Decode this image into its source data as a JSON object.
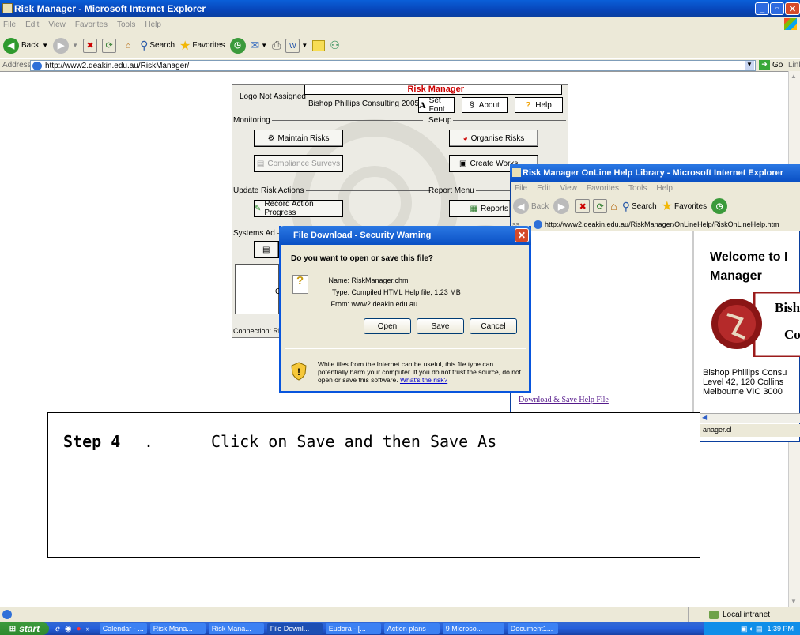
{
  "window": {
    "title": "Risk Manager - Microsoft Internet Explorer"
  },
  "menu": [
    "File",
    "Edit",
    "View",
    "Favorites",
    "Tools",
    "Help"
  ],
  "toolbar": {
    "back": "Back",
    "search": "Search",
    "favorites": "Favorites"
  },
  "address": {
    "label": "Address",
    "url": "http://www2.deakin.edu.au/RiskManager/",
    "go": "Go",
    "links": "Links"
  },
  "app": {
    "title": "Risk Manager",
    "logo": "Logo Not Assigned",
    "company": "Bishop Phillips Consulting 2005",
    "set_font": "Set Font",
    "about": "About",
    "help": "Help",
    "groups": {
      "monitoring": "Monitoring",
      "setup": "Set-up",
      "update": "Update Risk Actions",
      "report": "Report Menu",
      "systems": "Systems Ad"
    },
    "buttons": {
      "maintain": "Maintain Risks",
      "organise": "Organise Risks",
      "compliance": "Compliance Surveys",
      "create_workshop": "Create Works",
      "record": "Record Action Progress",
      "reports": "Reports"
    },
    "connection": "Connection: Ri",
    "partial_c": "C"
  },
  "help_window": {
    "title": "Risk Manager OnLine Help Library - Microsoft Internet Explorer",
    "url": "http://www2.deakin.edu.au/RiskManager/OnLineHelp/RiskOnLineHelp.htm",
    "addr_partial": "ss",
    "welcome_line1": "Welcome to I",
    "welcome_line2": "Manager",
    "logo_text1": "Bish",
    "logo_text2": "Co",
    "company_lines": [
      "Bishop Phillips Consu",
      "Level 42, 120 Collins",
      "Melbourne VIC 3000"
    ],
    "download_link": "Download & Save Help File",
    "status_partial": "anager.cl"
  },
  "dialog": {
    "title": "File Download - Security Warning",
    "question": "Do you want to open or save this file?",
    "name_label": "Name:",
    "name_value": "RiskManager.chm",
    "type_label": "Type:",
    "type_value": "Compiled HTML Help file, 1.23 MB",
    "from_label": "From:",
    "from_value": "www2.deakin.edu.au",
    "open": "Open",
    "save": "Save",
    "cancel": "Cancel",
    "warning": "While files from the Internet can be useful, this file type can potentially harm your computer. If you do not trust the source, do not open or save this software.",
    "risk_link": "What's the risk?"
  },
  "instruction": {
    "step": "Step 4",
    "dot": ".",
    "text": "Click on Save and then Save As"
  },
  "status": {
    "zone": "Local intranet"
  },
  "taskbar": {
    "start": "start",
    "tasks": [
      "Calendar - ...",
      "Risk Mana...",
      "Risk Mana...",
      "File Downl...",
      "Eudora - [...",
      "Action plans",
      "9 Microso...",
      "Document1..."
    ],
    "time": "1:39 PM"
  },
  "colors": {
    "xp_blue": "#0a50c4",
    "brand_red": "#cc0000",
    "link_purple": "#551a8b"
  }
}
